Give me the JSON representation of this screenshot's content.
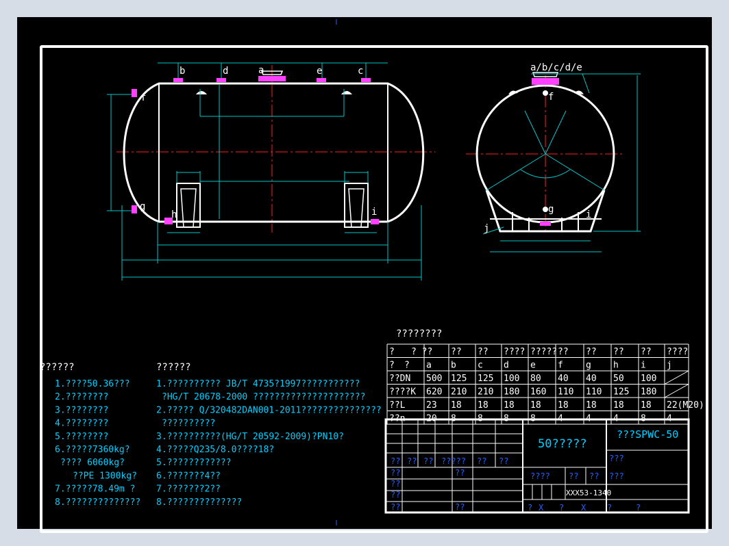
{
  "colors": {
    "background": "#d7dde6",
    "canvas": "#000000",
    "outline": "#ffffff",
    "dimension": "#00c8c8",
    "centerline": "#ff2020",
    "text": "#00d0ff",
    "nozzle": "#ff40ff"
  },
  "front_view": {
    "nozzle_labels": [
      "b",
      "d",
      "a",
      "e",
      "c",
      "f",
      "g",
      "h",
      "i"
    ]
  },
  "side_view": {
    "top_label": "a/b/c/d/e",
    "labels": [
      "f",
      "g",
      "i",
      "j"
    ]
  },
  "nozzle_table": {
    "title": "????????",
    "header_row1": [
      "?",
      "? ??",
      "??",
      "??",
      "????",
      "?????",
      "??",
      "??",
      "??",
      "??",
      "????"
    ],
    "header_row2": [
      "?",
      "?",
      "a",
      "b",
      "c",
      "d",
      "e",
      "f",
      "g",
      "h",
      "i",
      "j"
    ],
    "rows": [
      [
        "??DN",
        "500",
        "125",
        "125",
        "100",
        "80",
        "40",
        "40",
        "50",
        "100",
        ""
      ],
      [
        "????K",
        "620",
        "210",
        "210",
        "180",
        "160",
        "110",
        "110",
        "125",
        "180",
        ""
      ],
      [
        "??L",
        "23",
        "18",
        "18",
        "18",
        "18",
        "18",
        "18",
        "18",
        "18",
        "22(M20)"
      ],
      [
        "??n",
        "20",
        "8",
        "8",
        "8",
        "8",
        "4",
        "4",
        "4",
        "8",
        "4"
      ]
    ]
  },
  "notes_left": {
    "heading": "??????",
    "lines": [
      "1.????50.36???",
      "2.????????",
      "3.????????",
      "4.????????",
      "5.????????",
      "6.?????7360kg?",
      "???? 6060kg?",
      "??PE 1300kg?",
      "7.?????78.49m ?",
      "8.??????????????"
    ]
  },
  "notes_right": {
    "heading": "??????",
    "lines": [
      "1.?????????? JB/T 4735?1997???????????",
      "?HG/T 20678-2000 ?????????????????????",
      "2.????? Q/320482DAN001-2011???????????????",
      "??????????",
      "3.??????????(HG/T 20592-2009)?PN10?",
      "4.?????Q235/8.0????18?",
      "5.????????????",
      "6.???????4??",
      "7.???????2??",
      "8.??????????????"
    ]
  },
  "title_block": {
    "product_name": "50?????",
    "drawing_no": "???SPWC-50",
    "code": "XXX53-1340",
    "cell_labels": [
      "??",
      "??",
      "??",
      "?????",
      "??",
      "??",
      "??",
      "??",
      "??",
      "??",
      "??",
      "??",
      "??",
      "??",
      "????",
      "??",
      "??",
      "???",
      "???",
      "?",
      "X",
      "?",
      "X",
      "?",
      "?"
    ]
  }
}
